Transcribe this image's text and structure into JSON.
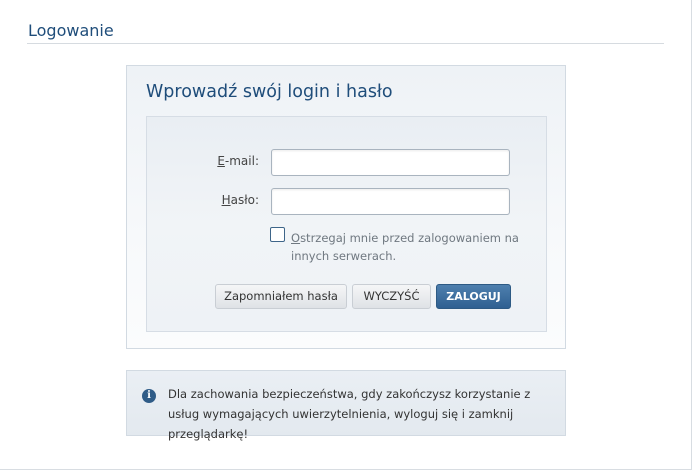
{
  "page": {
    "title": "Logowanie"
  },
  "login_panel": {
    "heading": "Wprowadź swój login i hasło",
    "email": {
      "label_accesskey": "E",
      "label_rest": "-mail:",
      "value": "",
      "placeholder": ""
    },
    "password": {
      "label_accesskey": "H",
      "label_rest": "asło:",
      "value": "",
      "placeholder": ""
    },
    "warn_checkbox": {
      "checked": false,
      "label_accesskey": "O",
      "label_rest": "strzegaj mnie przed zalogowaniem na innych serwerach."
    },
    "buttons": {
      "forgot": "Zapomniałem hasła",
      "clear": "WYCZYŚĆ",
      "login": "ZALOGUJ"
    }
  },
  "info": {
    "icon": "info-icon",
    "text": "Dla zachowania bezpieczeństwa, gdy zakończysz korzystanie z usług wymagających uwierzytelnienia, wyloguj się i zamknij przeglądarkę!"
  },
  "colors": {
    "heading": "#1f4d7a",
    "primary_button": "#3a6a9a",
    "checkbox_border": "#3e6589"
  }
}
